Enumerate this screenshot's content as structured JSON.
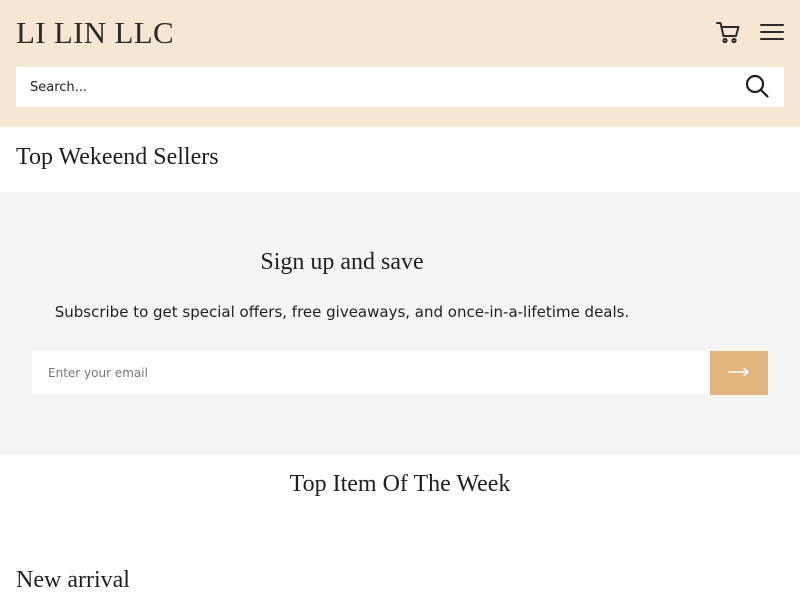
{
  "header": {
    "logo": "LI LIN LLC",
    "search_placeholder": "Search..."
  },
  "sections": {
    "top_weekend_sellers": "Top Wekeend Sellers",
    "top_item_of_week": "Top Item Of The Week",
    "new_arrival": "New arrival"
  },
  "signup": {
    "title": "Sign up and save",
    "text": "Subscribe to get special offers, free giveaways, and once-in-a-lifetime deals.",
    "email_placeholder": "Enter your email"
  },
  "colors": {
    "header_bg": "#f6e6d4",
    "signup_bg": "#f5f5f5",
    "accent": "#e2b57f"
  },
  "icons": {
    "cart": "cart-icon",
    "menu": "hamburger-menu-icon",
    "search": "search-icon",
    "submit": "arrow-right-icon"
  }
}
